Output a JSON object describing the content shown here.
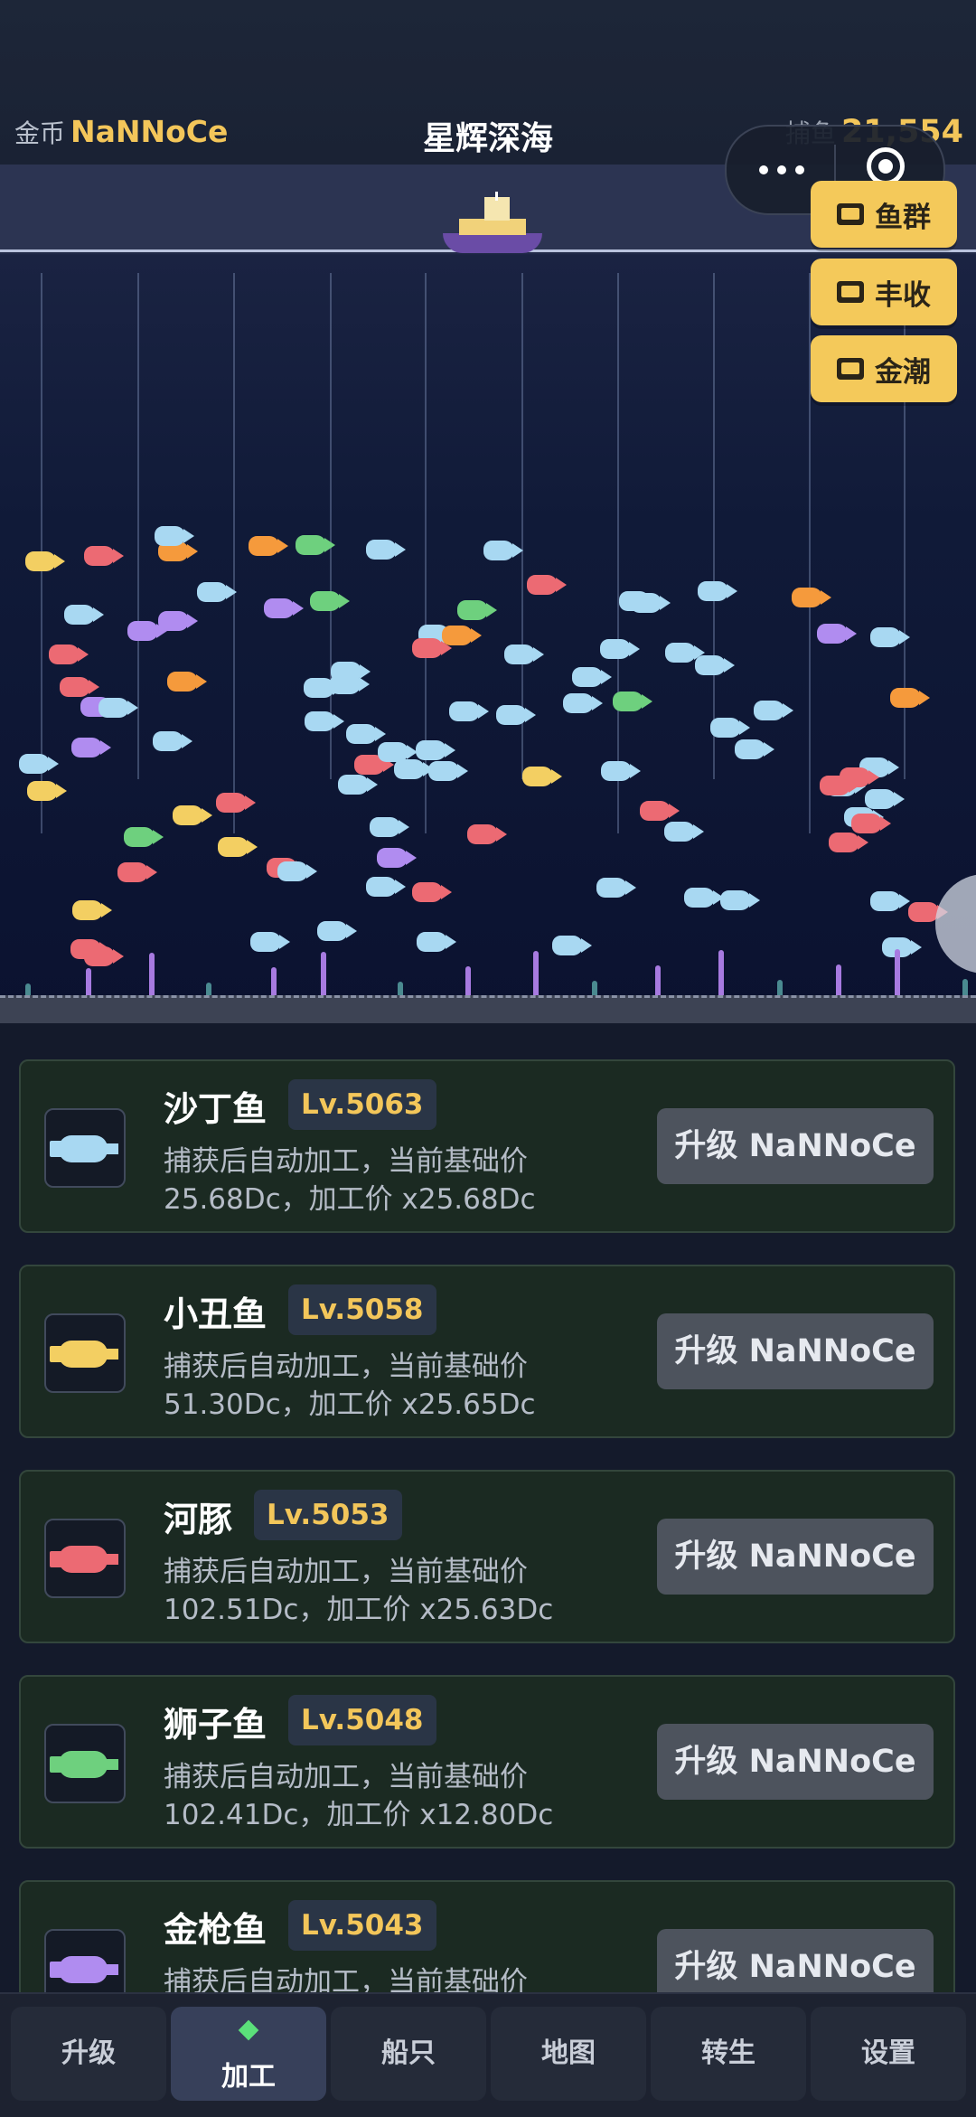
{
  "header": {
    "coins_label": "金币",
    "coins_value": "NaNNoCe",
    "title": "星辉深海",
    "catch_label": "捕鱼",
    "catch_value": "21,554"
  },
  "boosts": [
    {
      "label": "鱼群",
      "icon": "tv-icon"
    },
    {
      "label": "丰收",
      "icon": "tv-icon"
    },
    {
      "label": "金潮",
      "icon": "tv-icon"
    }
  ],
  "fish_cards": [
    {
      "name": "沙丁鱼",
      "level": "Lv.5063",
      "desc1": "捕获后自动加工，当前基础价",
      "desc2": "25.68Dc，加工价 x25.68Dc",
      "button": "升级 NaNNoCe",
      "color": "#a8d8f2"
    },
    {
      "name": "小丑鱼",
      "level": "Lv.5058",
      "desc1": "捕获后自动加工，当前基础价",
      "desc2": "51.30Dc，加工价 x25.65Dc",
      "button": "升级 NaNNoCe",
      "color": "#f3cf62"
    },
    {
      "name": "河豚",
      "level": "Lv.5053",
      "desc1": "捕获后自动加工，当前基础价",
      "desc2": "102.51Dc，加工价 x25.63Dc",
      "button": "升级 NaNNoCe",
      "color": "#ec6a73"
    },
    {
      "name": "狮子鱼",
      "level": "Lv.5048",
      "desc1": "捕获后自动加工，当前基础价",
      "desc2": "102.41Dc，加工价 x12.80Dc",
      "button": "升级 NaNNoCe",
      "color": "#6ed07e"
    },
    {
      "name": "金枪鱼",
      "level": "Lv.5043",
      "desc1": "捕获后自动加工，当前基础价",
      "desc2": "",
      "button": "升级 NaNNoCe",
      "color": "#b08cf0"
    }
  ],
  "nav": {
    "tabs": [
      "升级",
      "加工",
      "船只",
      "地图",
      "转生",
      "设置"
    ],
    "active": "加工"
  }
}
